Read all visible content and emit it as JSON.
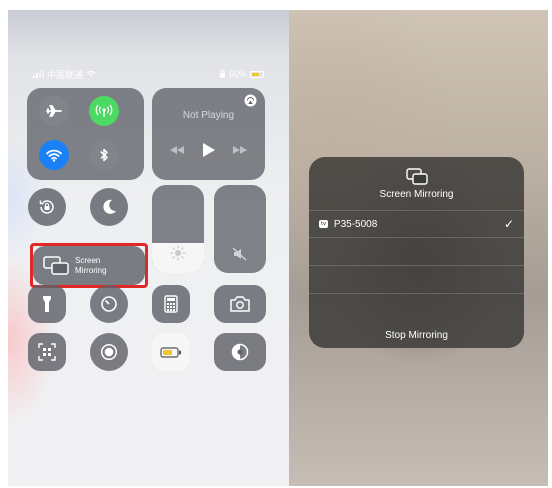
{
  "status_bar": {
    "carrier": "中国联通",
    "battery": "60%"
  },
  "now_playing": {
    "title": "Not Playing"
  },
  "screen_mirroring_tile": {
    "line1": "Screen",
    "line2": "Mirroring"
  },
  "mirror_popup": {
    "title": "Screen Mirroring",
    "device_badge": "tv",
    "device_name": "P35-5008",
    "selected_mark": "✓",
    "stop_label": "Stop Mirroring"
  },
  "sliders": {
    "brightness_level": 0.34,
    "volume_level": 0.0
  },
  "colors": {
    "green": "#4cd964",
    "blue": "#1a80f5",
    "highlight": "#e02828",
    "battery": "#f0c628"
  },
  "icons": [
    "airplane-icon",
    "cellular-icon",
    "wifi-icon",
    "bluetooth-icon",
    "airplay-icon",
    "rewind-icon",
    "play-icon",
    "fast-forward-icon",
    "rotation-lock-icon",
    "moon-icon",
    "sun-icon",
    "mute-icon",
    "screen-mirroring-icon",
    "flashlight-icon",
    "timer-icon",
    "calculator-icon",
    "camera-icon",
    "qr-code-icon",
    "record-icon",
    "low-power-icon",
    "dark-mode-icon",
    "checkmark-icon"
  ]
}
